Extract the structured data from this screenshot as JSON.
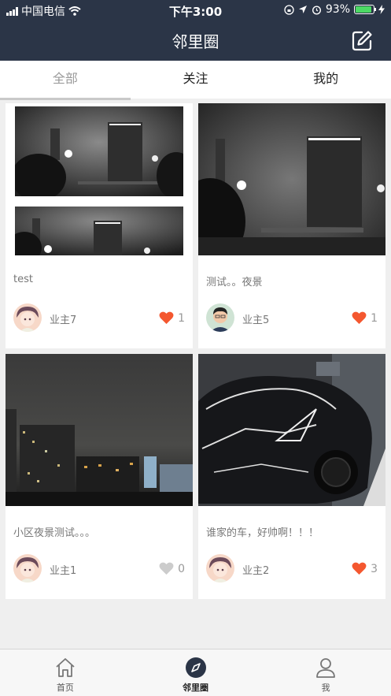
{
  "status_bar": {
    "carrier": "中国电信",
    "time": "下午3:00",
    "battery_text": "93%",
    "battery_level": 0.93
  },
  "nav": {
    "title": "邻里圈",
    "edit_icon": "edit-icon"
  },
  "tabs": [
    {
      "label": "全部",
      "active": true
    },
    {
      "label": "关注",
      "active": false
    },
    {
      "label": "我的",
      "active": false
    }
  ],
  "posts": [
    {
      "text": "test",
      "author": "业主7",
      "likes": "1",
      "liked": true,
      "avatar": "anime-avatar"
    },
    {
      "text": "测试。。夜景",
      "author": "业主5",
      "likes": "1",
      "liked": true,
      "avatar": "person-avatar"
    },
    {
      "text": "小区夜景测试。。。",
      "author": "业主1",
      "likes": "0",
      "liked": false,
      "avatar": "anime-avatar"
    },
    {
      "text": "谁家的车，好帅啊！！！",
      "author": "业主2",
      "likes": "3",
      "liked": true,
      "avatar": "anime-avatar"
    }
  ],
  "tab_bar": [
    {
      "label": "首页",
      "icon": "home-icon",
      "active": false
    },
    {
      "label": "邻里圈",
      "icon": "compass-icon",
      "active": true
    },
    {
      "label": "我",
      "icon": "user-icon",
      "active": false
    }
  ],
  "colors": {
    "header_bg": "#2b3547",
    "like_red": "#f4572f",
    "like_grey": "#cccccc"
  }
}
